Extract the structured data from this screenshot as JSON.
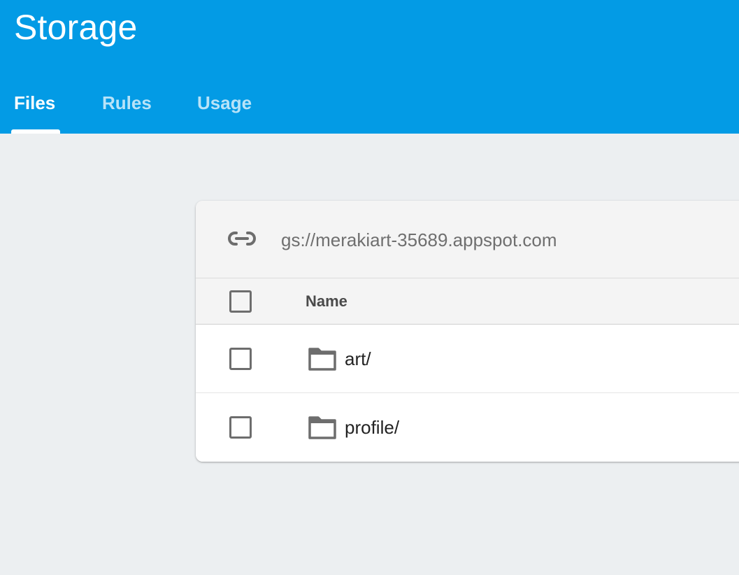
{
  "header": {
    "title": "Storage",
    "background_color": "#039be5"
  },
  "tabs": [
    {
      "label": "Files",
      "active": true
    },
    {
      "label": "Rules",
      "active": false
    },
    {
      "label": "Usage",
      "active": false
    }
  ],
  "bucket": {
    "url": "gs://merakiart-35689.appspot.com",
    "icon": "link-icon"
  },
  "table": {
    "columns": [
      "Name"
    ],
    "rows": [
      {
        "name": "art/",
        "icon": "folder-icon",
        "checked": false
      },
      {
        "name": "profile/",
        "icon": "folder-icon",
        "checked": false
      }
    ]
  }
}
